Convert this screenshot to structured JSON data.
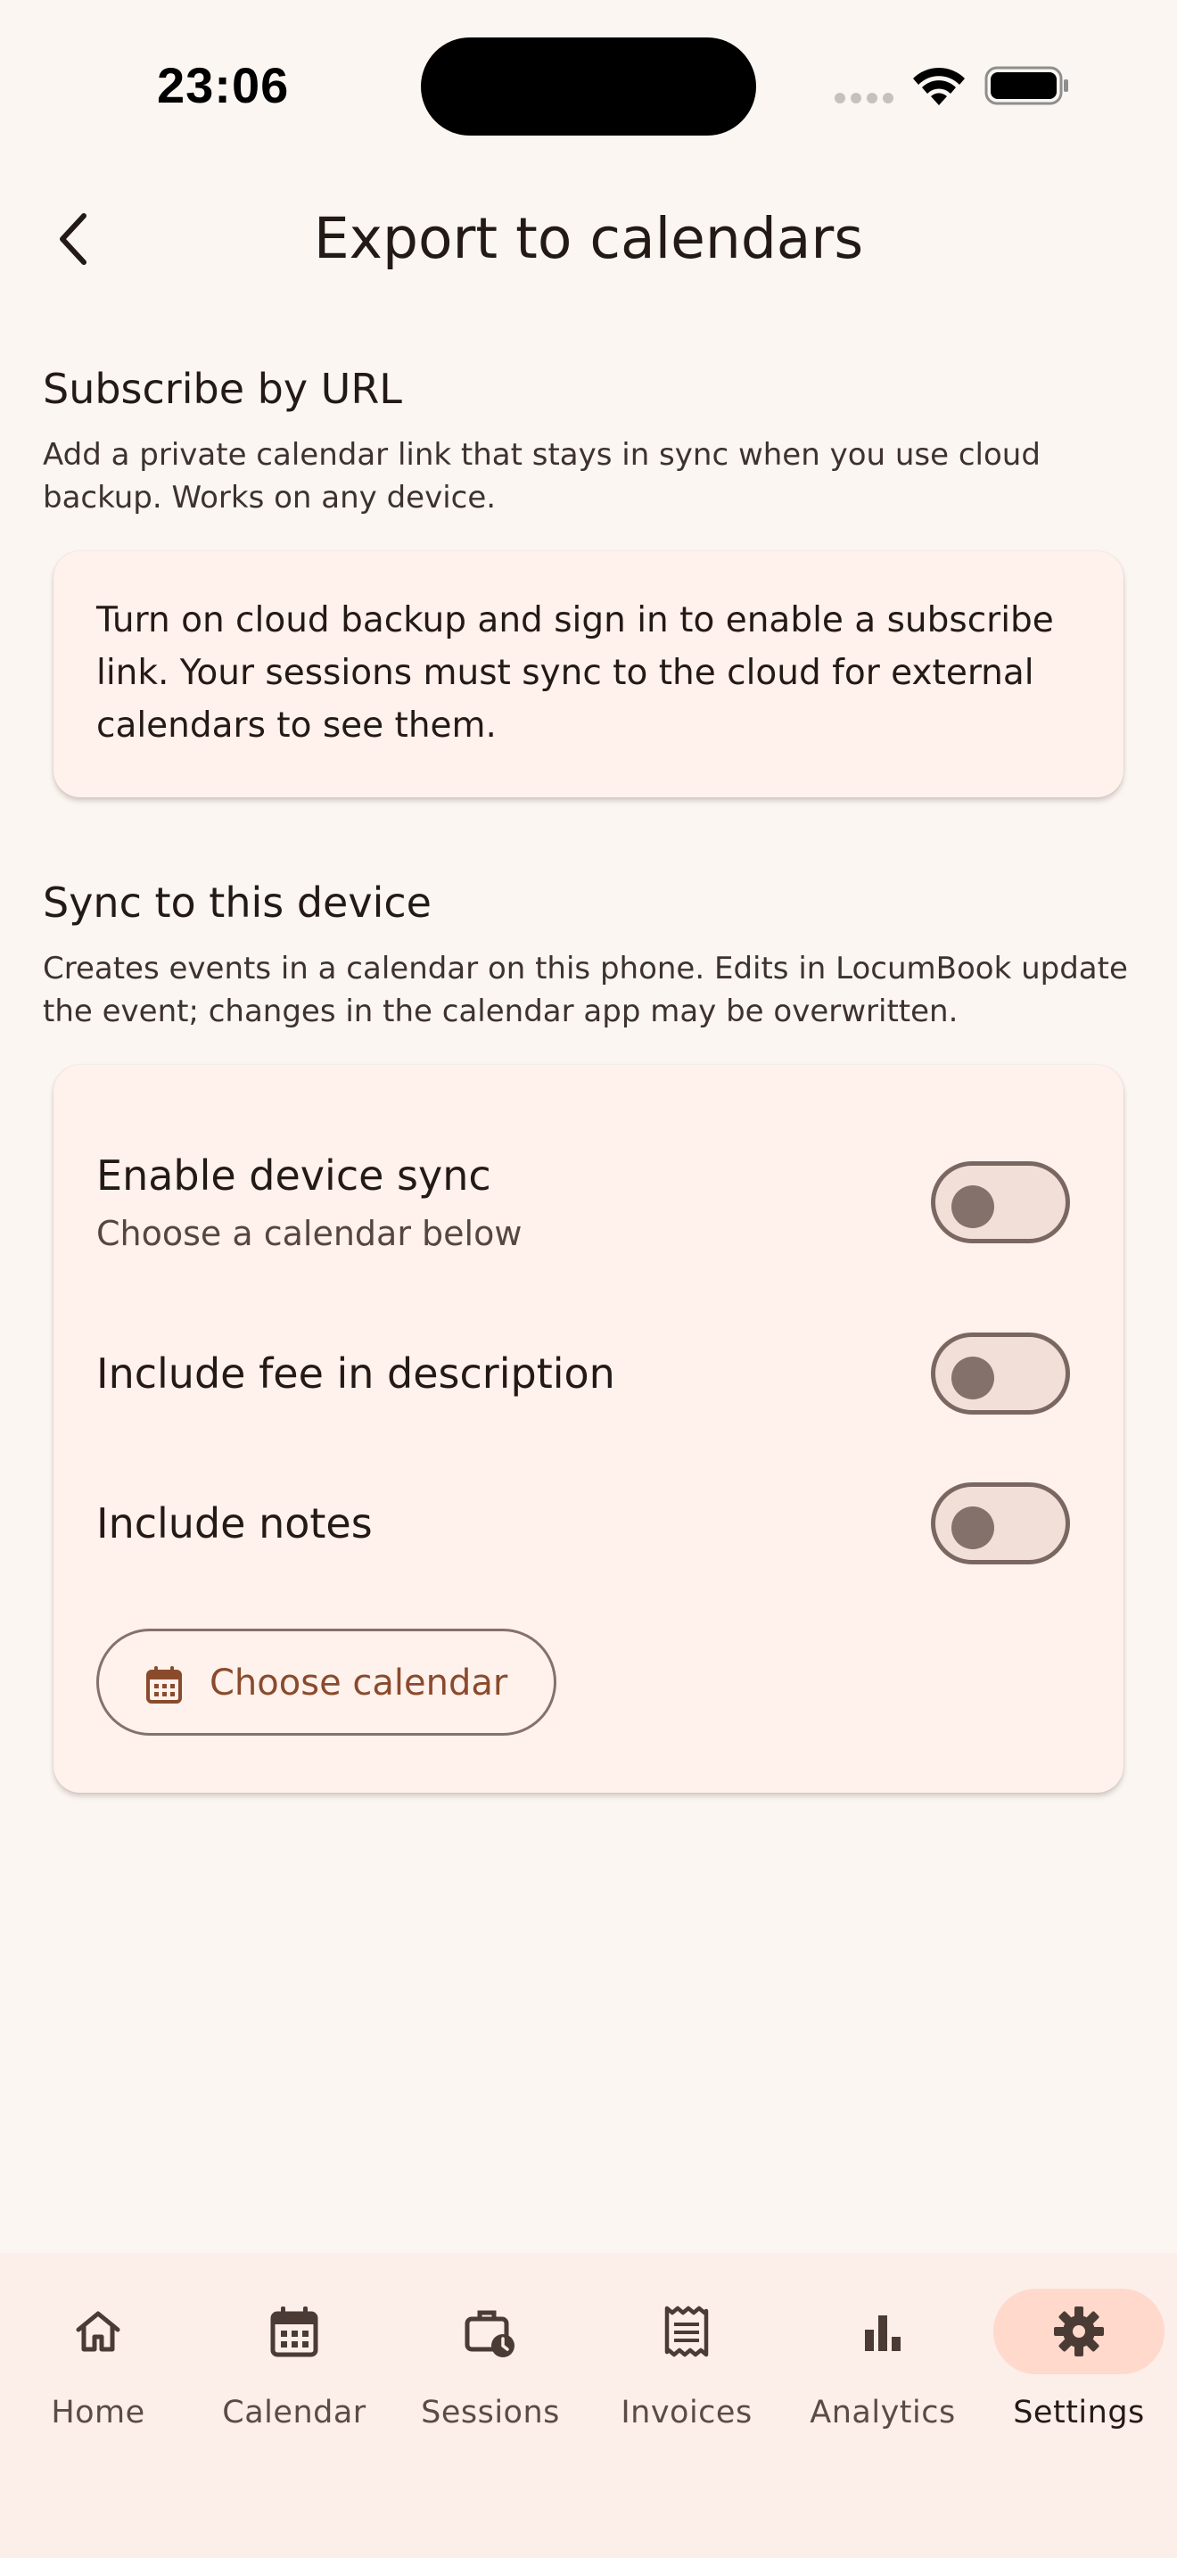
{
  "status_bar": {
    "time": "23:06"
  },
  "header": {
    "title": "Export to calendars",
    "back_icon": "chevron-left-icon"
  },
  "subscribe": {
    "heading": "Subscribe by URL",
    "description": "Add a private calendar link that stays in sync when you use cloud backup. Works on any device.",
    "info": "Turn on cloud backup and sign in to enable a subscribe link. Your sessions must sync to the cloud for external calendars to see them."
  },
  "device_sync": {
    "heading": "Sync to this device",
    "description": "Creates events in a calendar on this phone. Edits in LocumBook update the event; changes in the calendar app may be overwritten.",
    "toggles": [
      {
        "label": "Enable device sync",
        "subtitle": "Choose a calendar below",
        "on": false
      },
      {
        "label": "Include fee in description",
        "on": false
      },
      {
        "label": "Include notes",
        "on": false
      }
    ],
    "choose_calendar_label": "Choose calendar"
  },
  "bottom_nav": {
    "items": [
      {
        "label": "Home",
        "icon": "home-icon",
        "active": false
      },
      {
        "label": "Calendar",
        "icon": "calendar-icon",
        "active": false
      },
      {
        "label": "Sessions",
        "icon": "briefcase-clock-icon",
        "active": false
      },
      {
        "label": "Invoices",
        "icon": "receipt-icon",
        "active": false
      },
      {
        "label": "Analytics",
        "icon": "bar-chart-icon",
        "active": false
      },
      {
        "label": "Settings",
        "icon": "gear-icon",
        "active": true
      }
    ]
  },
  "colors": {
    "background": "#fbf6f2",
    "card": "#fff1ec",
    "accent": "#8a4b2c",
    "nav_background": "#fceee9",
    "nav_indicator": "#ffd9cb"
  }
}
